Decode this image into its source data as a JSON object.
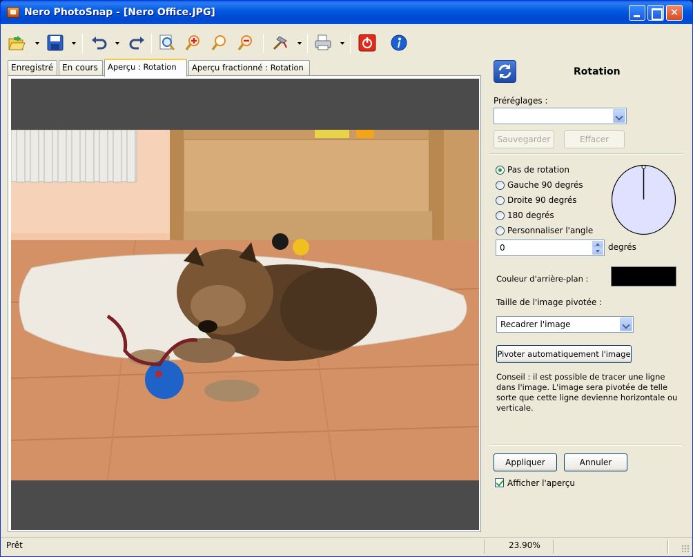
{
  "window": {
    "title": "Nero PhotoSnap - [Nero Office.JPG]",
    "minimize_label": "",
    "maximize_label": "",
    "close_label": "✕"
  },
  "toolbar": {
    "items": [
      "open-icon",
      "save-icon",
      "undo-icon",
      "redo-icon",
      "zoom-fit-icon",
      "zoom-in-icon",
      "zoom-icon",
      "zoom-out-icon",
      "tools-icon",
      "print-icon",
      "power-icon",
      "info-icon"
    ]
  },
  "tabs": [
    {
      "label": "Enregistré",
      "active": false
    },
    {
      "label": "En cours",
      "active": false
    },
    {
      "label": "Aperçu : Rotation",
      "active": true
    },
    {
      "label": "Aperçu fractionné : Rotation",
      "active": false
    }
  ],
  "panel": {
    "title": "Rotation",
    "presets_label": "Préréglages :",
    "presets_value": "",
    "save_button": "Sauvegarder",
    "delete_button": "Effacer",
    "options": [
      {
        "label": "Pas de rotation",
        "selected": true
      },
      {
        "label": "Gauche 90 degrés",
        "selected": false
      },
      {
        "label": "Droite 90 degrés",
        "selected": false
      },
      {
        "label": "180 degrés",
        "selected": false
      },
      {
        "label": "Personnaliser l'angle",
        "selected": false
      }
    ],
    "angle_value": "0",
    "angle_unit": "degrés",
    "background_color_label": "Couleur d'arrière-plan :",
    "background_color": "#000000",
    "rotated_size_label": "Taille de l'image pivotée :",
    "rotated_size_value": "Recadrer l'image",
    "auto_rotate_button": "Pivoter automatiquement l'image",
    "tip": "Conseil : il est possible de tracer une ligne dans l'image. L'image sera pivotée de telle sorte que cette ligne devienne horizontale ou verticale.",
    "apply_button": "Appliquer",
    "cancel_button": "Annuler",
    "show_preview_label": "Afficher l'aperçu",
    "show_preview_checked": true
  },
  "status": {
    "text": "Prêt",
    "zoom": "23.90%"
  },
  "colors": {
    "accent": "#0054e3",
    "canvas": "#4b4b4b"
  }
}
